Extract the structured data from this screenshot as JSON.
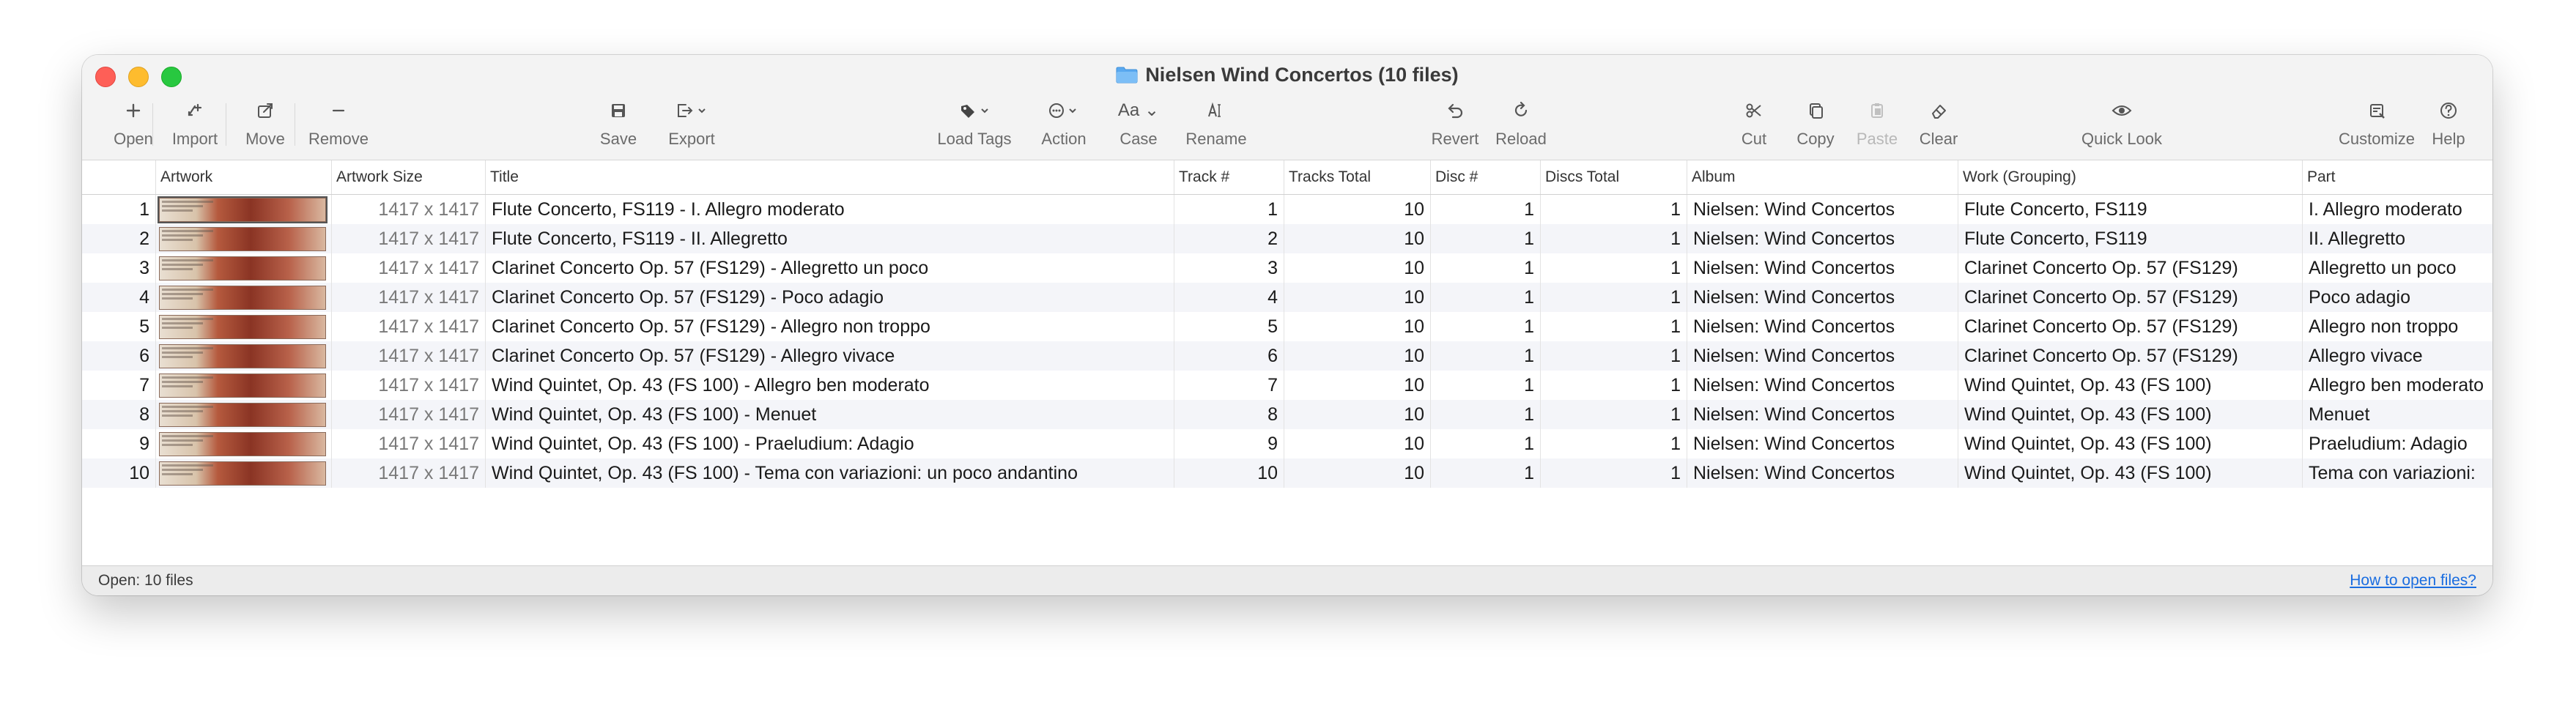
{
  "window": {
    "title": "Nielsen Wind Concertos (10 files)"
  },
  "toolbar": {
    "open": "Open",
    "import": "Import",
    "move": "Move",
    "remove": "Remove",
    "save": "Save",
    "export": "Export",
    "load_tags": "Load Tags",
    "action": "Action",
    "case": "Case",
    "case_glyph": "Aa",
    "rename": "Rename",
    "revert": "Revert",
    "reload": "Reload",
    "cut": "Cut",
    "copy": "Copy",
    "paste": "Paste",
    "clear": "Clear",
    "quick_look": "Quick Look",
    "customize": "Customize",
    "help": "Help"
  },
  "columns": {
    "artwork": "Artwork",
    "artwork_size": "Artwork Size",
    "title": "Title",
    "track": "Track #",
    "tracks_total": "Tracks Total",
    "disc": "Disc #",
    "discs_total": "Discs Total",
    "album": "Album",
    "work": "Work (Grouping)",
    "part": "Part"
  },
  "rows": [
    {
      "num": "1",
      "size": "1417 x 1417",
      "title": "Flute Concerto, FS119 - I. Allegro moderato",
      "track": "1",
      "tracks_total": "10",
      "disc": "1",
      "discs_total": "1",
      "album": "Nielsen: Wind Concertos",
      "work": "Flute Concerto, FS119",
      "part": "I. Allegro moderato"
    },
    {
      "num": "2",
      "size": "1417 x 1417",
      "title": "Flute Concerto, FS119 - II. Allegretto",
      "track": "2",
      "tracks_total": "10",
      "disc": "1",
      "discs_total": "1",
      "album": "Nielsen: Wind Concertos",
      "work": "Flute Concerto, FS119",
      "part": "II. Allegretto"
    },
    {
      "num": "3",
      "size": "1417 x 1417",
      "title": "Clarinet Concerto Op. 57 (FS129) - Allegretto un poco",
      "track": "3",
      "tracks_total": "10",
      "disc": "1",
      "discs_total": "1",
      "album": "Nielsen: Wind Concertos",
      "work": "Clarinet Concerto Op. 57 (FS129)",
      "part": "Allegretto un poco"
    },
    {
      "num": "4",
      "size": "1417 x 1417",
      "title": "Clarinet Concerto Op. 57 (FS129) - Poco adagio",
      "track": "4",
      "tracks_total": "10",
      "disc": "1",
      "discs_total": "1",
      "album": "Nielsen: Wind Concertos",
      "work": "Clarinet Concerto Op. 57 (FS129)",
      "part": "Poco adagio"
    },
    {
      "num": "5",
      "size": "1417 x 1417",
      "title": "Clarinet Concerto Op. 57 (FS129) - Allegro non troppo",
      "track": "5",
      "tracks_total": "10",
      "disc": "1",
      "discs_total": "1",
      "album": "Nielsen: Wind Concertos",
      "work": "Clarinet Concerto Op. 57 (FS129)",
      "part": "Allegro non troppo"
    },
    {
      "num": "6",
      "size": "1417 x 1417",
      "title": "Clarinet Concerto Op. 57 (FS129) - Allegro vivace",
      "track": "6",
      "tracks_total": "10",
      "disc": "1",
      "discs_total": "1",
      "album": "Nielsen: Wind Concertos",
      "work": "Clarinet Concerto Op. 57 (FS129)",
      "part": "Allegro vivace"
    },
    {
      "num": "7",
      "size": "1417 x 1417",
      "title": "Wind Quintet, Op. 43 (FS 100) - Allegro ben moderato",
      "track": "7",
      "tracks_total": "10",
      "disc": "1",
      "discs_total": "1",
      "album": "Nielsen: Wind Concertos",
      "work": "Wind Quintet, Op. 43 (FS 100)",
      "part": "Allegro ben moderato"
    },
    {
      "num": "8",
      "size": "1417 x 1417",
      "title": "Wind Quintet, Op. 43 (FS 100) - Menuet",
      "track": "8",
      "tracks_total": "10",
      "disc": "1",
      "discs_total": "1",
      "album": "Nielsen: Wind Concertos",
      "work": "Wind Quintet, Op. 43 (FS 100)",
      "part": "Menuet"
    },
    {
      "num": "9",
      "size": "1417 x 1417",
      "title": "Wind Quintet, Op. 43 (FS 100) - Praeludium: Adagio",
      "track": "9",
      "tracks_total": "10",
      "disc": "1",
      "discs_total": "1",
      "album": "Nielsen: Wind Concertos",
      "work": "Wind Quintet, Op. 43 (FS 100)",
      "part": "Praeludium: Adagio"
    },
    {
      "num": "10",
      "size": "1417 x 1417",
      "title": "Wind Quintet, Op. 43 (FS 100) - Tema con variazioni: un poco andantino",
      "track": "10",
      "tracks_total": "10",
      "disc": "1",
      "discs_total": "1",
      "album": "Nielsen: Wind Concertos",
      "work": "Wind Quintet, Op. 43 (FS 100)",
      "part": "Tema con variazioni:"
    }
  ],
  "status": {
    "left": "Open: 10 files",
    "right": "How to open files?"
  }
}
